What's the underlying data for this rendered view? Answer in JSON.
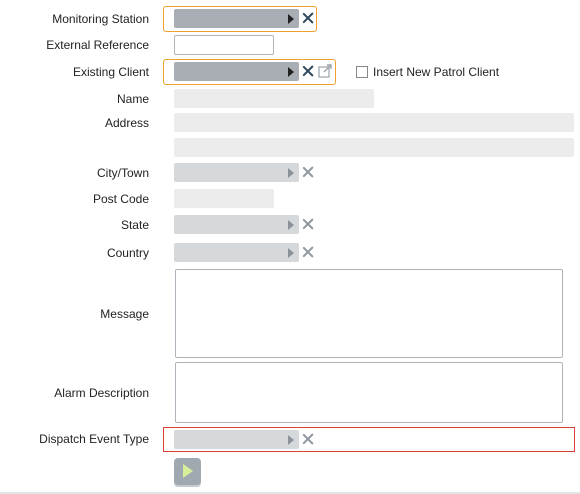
{
  "form": {
    "monitoring_station": {
      "label": "Monitoring Station",
      "value": ""
    },
    "external_reference": {
      "label": "External Reference",
      "value": ""
    },
    "existing_client": {
      "label": "Existing Client",
      "value": ""
    },
    "insert_new_patrol_client": {
      "label": "Insert New Patrol Client",
      "checked": false
    },
    "name": {
      "label": "Name",
      "value": ""
    },
    "address": {
      "label": "Address",
      "line1": "",
      "line2": ""
    },
    "city_town": {
      "label": "City/Town",
      "value": ""
    },
    "post_code": {
      "label": "Post Code",
      "value": ""
    },
    "state": {
      "label": "State",
      "value": ""
    },
    "country": {
      "label": "Country",
      "value": ""
    },
    "message": {
      "label": "Message",
      "value": ""
    },
    "alarm_description": {
      "label": "Alarm Description",
      "value": ""
    },
    "dispatch_event_type": {
      "label": "Dispatch Event Type",
      "value": ""
    }
  },
  "icons": {
    "dropdown": "triangle-right-icon",
    "clear": "close-icon",
    "open_external": "external-link-icon",
    "submit": "play-icon"
  },
  "colors": {
    "required_highlight": "#f0a030",
    "error_highlight": "#d9403a",
    "submit_arrow": "#d8ef9a"
  }
}
